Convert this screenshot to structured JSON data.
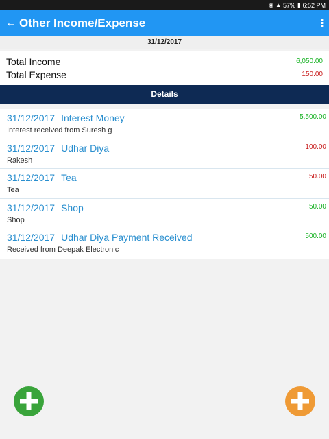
{
  "status": {
    "battery": "57%",
    "time": "6:52 PM"
  },
  "app_bar": {
    "title": "Other Income/Expense"
  },
  "date": "31/12/2017",
  "totals": {
    "income_label": "Total Income",
    "income_value": "6,050.00",
    "expense_label": "Total Expense",
    "expense_value": "150.00"
  },
  "details_label": "Details",
  "items": [
    {
      "date": "31/12/2017",
      "name": "Interest Money",
      "note": "Interest received from Suresh g",
      "amount": "5,500.00",
      "type": "income"
    },
    {
      "date": "31/12/2017",
      "name": "Udhar Diya",
      "note": "Rakesh",
      "amount": "100.00",
      "type": "expense"
    },
    {
      "date": "31/12/2017",
      "name": "Tea",
      "note": "Tea",
      "amount": "50.00",
      "type": "expense"
    },
    {
      "date": "31/12/2017",
      "name": "Shop",
      "note": "Shop",
      "amount": "50.00",
      "type": "income"
    },
    {
      "date": "31/12/2017",
      "name": "Udhar Diya Payment Received",
      "note": "Received from Deepak Electronic",
      "amount": "500.00",
      "type": "income"
    }
  ],
  "colors": {
    "app_bar": "#2196f3",
    "details_bar": "#0e2a54",
    "income": "#18b224",
    "expense": "#c81c1c",
    "link": "#2a8fcf",
    "fab_income": "#3aa43b",
    "fab_expense": "#ef9a35"
  },
  "icons": {
    "back": "arrow-left-icon",
    "menu": "more-vertical-icon",
    "fab_left": "plus-icon",
    "fab_right": "plus-icon"
  }
}
